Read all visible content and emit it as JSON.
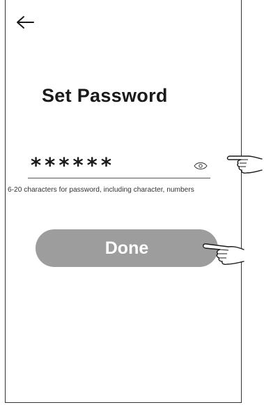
{
  "header": {
    "back_icon": "back-arrow-icon"
  },
  "page": {
    "title": "Set Password"
  },
  "password": {
    "value": "******",
    "toggle_icon": "eye-icon"
  },
  "hint": {
    "text": "6-20 characters for password, including character, numbers"
  },
  "actions": {
    "done_label": "Done"
  },
  "annotations": {
    "pointer_icon": "pointing-hand-icon"
  },
  "colors": {
    "button_bg": "#9d9d9d",
    "button_text": "#ffffff",
    "text": "#1a1a1a"
  }
}
